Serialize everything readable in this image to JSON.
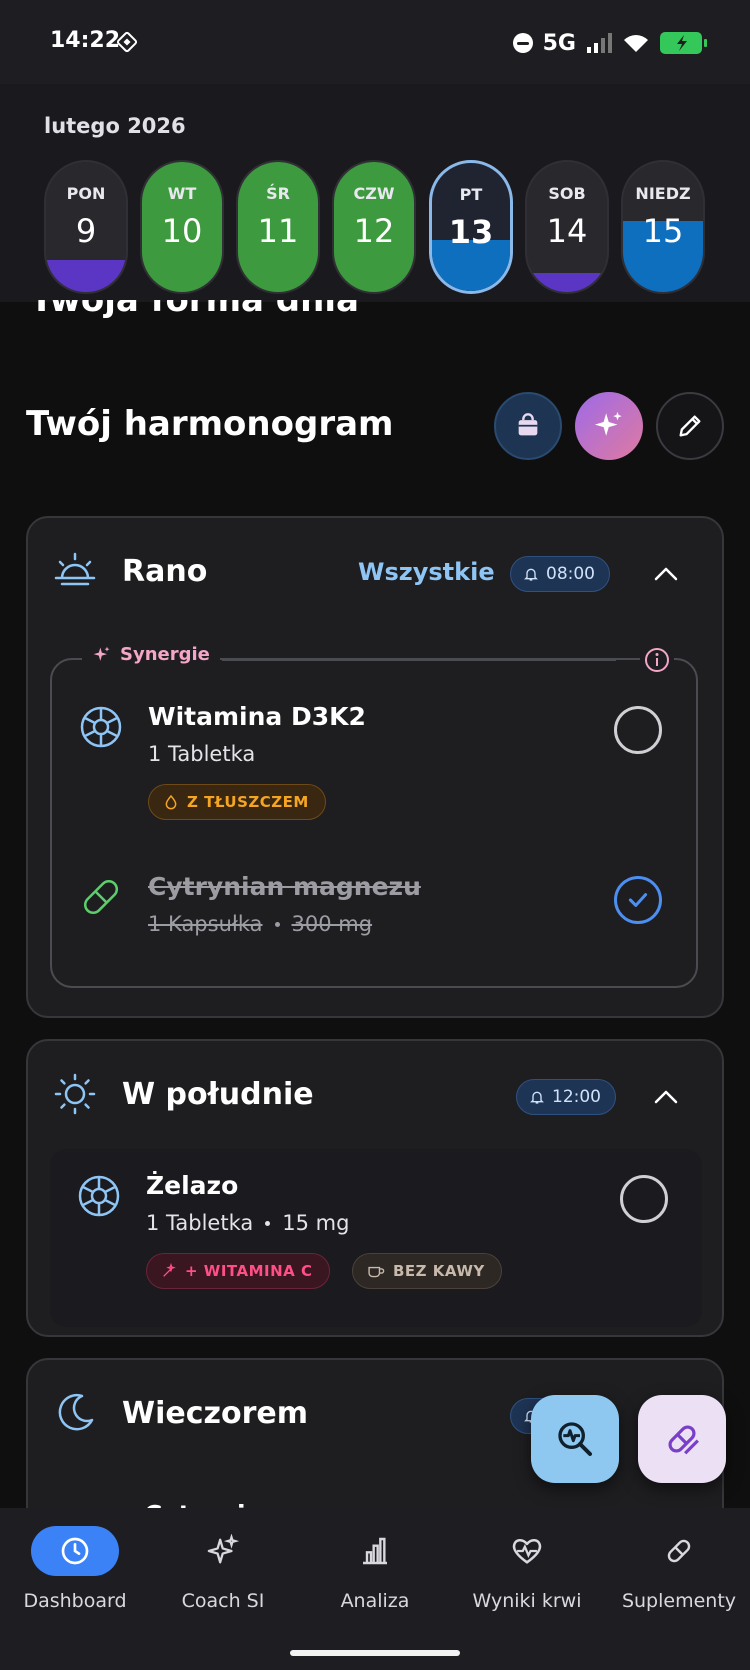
{
  "status_bar": {
    "time": "14:22",
    "network": "5G",
    "battery_color": "#34c759"
  },
  "calendar": {
    "month": "lutego 2026",
    "days": [
      {
        "name": "PON",
        "num": "9",
        "fill_color": "#5b35c4",
        "fill_fraction": 0.25
      },
      {
        "name": "WT",
        "num": "10",
        "fill_color": "#3e9a3e",
        "fill_fraction": 1.0
      },
      {
        "name": "ŚR",
        "num": "11",
        "fill_color": "#3e9a3e",
        "fill_fraction": 1.0
      },
      {
        "name": "CZW",
        "num": "12",
        "fill_color": "#3e9a3e",
        "fill_fraction": 1.0
      },
      {
        "name": "PT",
        "num": "13",
        "fill_color": "#0f6fbf",
        "fill_fraction": 0.4,
        "selected": true
      },
      {
        "name": "SOB",
        "num": "14",
        "fill_color": "#5b35c4",
        "fill_fraction": 0.15
      },
      {
        "name": "NIEDZ",
        "num": "15",
        "fill_color": "#0f6fbf",
        "fill_fraction": 0.55
      }
    ]
  },
  "ghost_heading": "Twoja forma dnia",
  "schedule": {
    "title": "Twój harmonogram",
    "morning": {
      "title": "Rano",
      "all_label": "Wszystkie",
      "time": "08:00",
      "synergy_label": "Synergie",
      "items": [
        {
          "name": "Witamina D3K2",
          "dose": "1 Tabletka",
          "tag": "Z TŁUSZCZEM",
          "done": false
        },
        {
          "name": "Cytrynian magnezu",
          "dose": "1 Kapsułka",
          "amount": "300 mg",
          "done": true
        }
      ]
    },
    "noon": {
      "title": "W południe",
      "time": "12:00",
      "items": [
        {
          "name": "Żelazo",
          "dose": "1 Tabletka",
          "amount": "15 mg",
          "tags": [
            "+ WITAMINA C",
            "BEZ KAWY"
          ],
          "done": false
        }
      ]
    },
    "evening": {
      "title": "Wieczorem",
      "items": [
        {
          "name": "Cytrynian magnezu"
        }
      ]
    }
  },
  "nav": {
    "items": [
      {
        "label": "Dashboard",
        "icon": "clock-icon",
        "active": true
      },
      {
        "label": "Coach SI",
        "icon": "sparkles-icon"
      },
      {
        "label": "Analiza",
        "icon": "bar-chart-icon"
      },
      {
        "label": "Wyniki krwi",
        "icon": "heart-pulse-icon"
      },
      {
        "label": "Suplementy",
        "icon": "pill-icon"
      }
    ]
  }
}
